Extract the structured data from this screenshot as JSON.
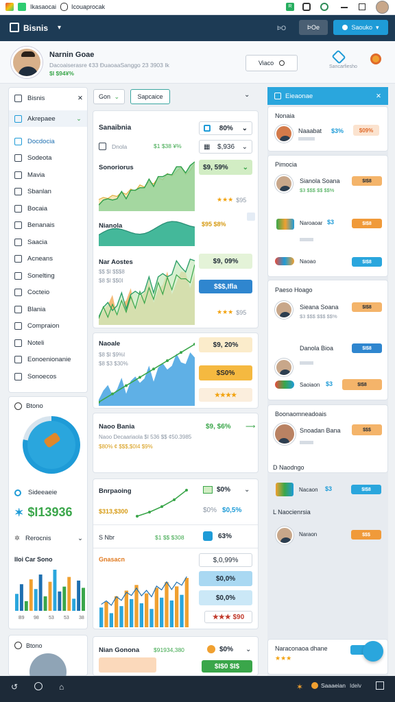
{
  "statusbar": {
    "app1": "Ikasaocai",
    "app2": "Icouaprocak",
    "badge": "R"
  },
  "appbar": {
    "title": "Bisnis",
    "btn1": "ÞO",
    "btn2": "ÞOe",
    "btn3": "Saouko"
  },
  "profile": {
    "name": "Narnin Goae",
    "subtitle": "Dacoaiserasre ¢33 ĐuaoaaSanggo 23 3903 Ik",
    "value": "$I $94¥%",
    "search_label": "Viaco",
    "right_label": "Sancarfiesho"
  },
  "sidebar": {
    "header": "Bisnis",
    "accordion": "Akrepaee",
    "items": [
      "Docdocia",
      "Sodeota",
      "Mavia",
      "Sbanlan",
      "Bocaia",
      "Benanais",
      "Saacia",
      "Acneans",
      "Sonelting",
      "Cocteio",
      "Blania",
      "Compraion",
      "Noteli",
      "Eonoenionanie",
      "Sonoecos"
    ],
    "widget_title": "Btono",
    "stat_label": "Sideeaeie",
    "stat_value": "$I13936",
    "reports_label": "Rerocnis",
    "chart_title": "IIoi Car Sono",
    "bars": [
      14,
      22,
      8,
      26,
      18,
      30,
      12,
      24,
      34,
      16,
      20,
      28,
      10,
      25,
      19
    ],
    "bar_axis": [
      "B9",
      "98",
      "53",
      "53",
      "38"
    ]
  },
  "filters": {
    "select": "Gon",
    "tag": "Sapcaice"
  },
  "card1": {
    "title": "Sanaibnia",
    "sub_label": "Dnola",
    "sub_value": "$1 $38 ¥%",
    "section2": "Sonoriorus",
    "section3": "Nianola",
    "section4": "Nar Aostes",
    "section4_sub": "$$ $I $$$8",
    "section4_sub2": "$8 $I $$0I",
    "badges": [
      "80%",
      "$,936",
      "$9, 59%",
      "$95 $8%",
      "$9, 09%",
      "$$$,Ifla",
      "$95"
    ],
    "stars": "★★★"
  },
  "card2": {
    "title": "Naoale",
    "sub1": "$8 $I $9%I",
    "sub2": "$8 $3 $30%",
    "badges": [
      "$9, 20%",
      "$S0%",
      "★★★★"
    ],
    "series": [
      10,
      14,
      12,
      18,
      16,
      24,
      20,
      30,
      26,
      38,
      34,
      44,
      40,
      52,
      48,
      60,
      55,
      64,
      72,
      58,
      66,
      80
    ]
  },
  "card3": {
    "title": "Naoo Bania",
    "sub": "Naoo Decaariaola $I 536 $$ ¢50.3985",
    "sub2": "$80% ¢ $$$,$0I4 $9%",
    "value": "$9, $6%"
  },
  "card4": {
    "title": "Bnrpaoing",
    "value": "$0%",
    "sub": "$313,$300",
    "badge1": "$0%",
    "badge2": "$0,5%",
    "row2_label": "S Nbr",
    "row2_value": "$1 $$ $308",
    "row2_badge": "63%",
    "chart_title": "Gnasacn",
    "badges": [
      "$,0,99%",
      "$0,0%",
      "$0,0%",
      "★★★ $90"
    ],
    "bars": [
      28,
      36,
      20,
      44,
      30,
      52,
      40,
      60,
      34,
      48,
      26,
      56,
      42,
      64,
      38,
      58,
      46,
      70
    ]
  },
  "card5": {
    "title": "Nian Gonona",
    "sub": "$91934,380",
    "value": "$0%",
    "badge": "$I$0 $I$"
  },
  "right_panel": {
    "header": "Eieaonae",
    "sections": [
      {
        "title": "Nonaia",
        "items": [
          {
            "name": "Naaabat",
            "value": "$3%",
            "badge": "$09%"
          }
        ]
      },
      {
        "title": "Pimocia",
        "items": [
          {
            "name": "Sianola Soana",
            "value": "$3 $$$ $$ $$%",
            "badge": "$I$8"
          },
          {
            "name": "Naroaoar",
            "value": "$3",
            "badge": "$I$8"
          },
          {
            "name": "Naoao",
            "value": "",
            "badge": "$I$8"
          }
        ]
      },
      {
        "title": "Paeso Hoago",
        "items": [
          {
            "name": "Sieana Soana",
            "value": "$3 $$$ $$$ $$%",
            "badge": "$I$8"
          },
          {
            "name": "Danola Bioa",
            "value": "",
            "badge": "$I$8"
          },
          {
            "name": "Saoiaon",
            "value": "$3",
            "badge": "$I$8"
          }
        ]
      },
      {
        "title": "Boonaomneadoais",
        "items": [
          {
            "name": "Snoadan Bana",
            "value": "",
            "badge": "$$$"
          },
          {
            "name": "Nacaon",
            "value": "$3",
            "badge": "$I$8"
          },
          {
            "name": "Naraon",
            "value": "",
            "badge": "$$$"
          }
        ]
      }
    ],
    "sub_heads": [
      "D Naodngo",
      "L Naocienrsia"
    ],
    "bottom_label": "Naraconaoa dhane",
    "bottom_stars": "★★★"
  },
  "bottombar": {
    "label": "Saaaeian",
    "label2": "Idelv"
  },
  "colors": {
    "accent": "#1e9bd7",
    "nav": "#1d3b55",
    "green": "#3aa64a",
    "orange": "#f0a030"
  }
}
